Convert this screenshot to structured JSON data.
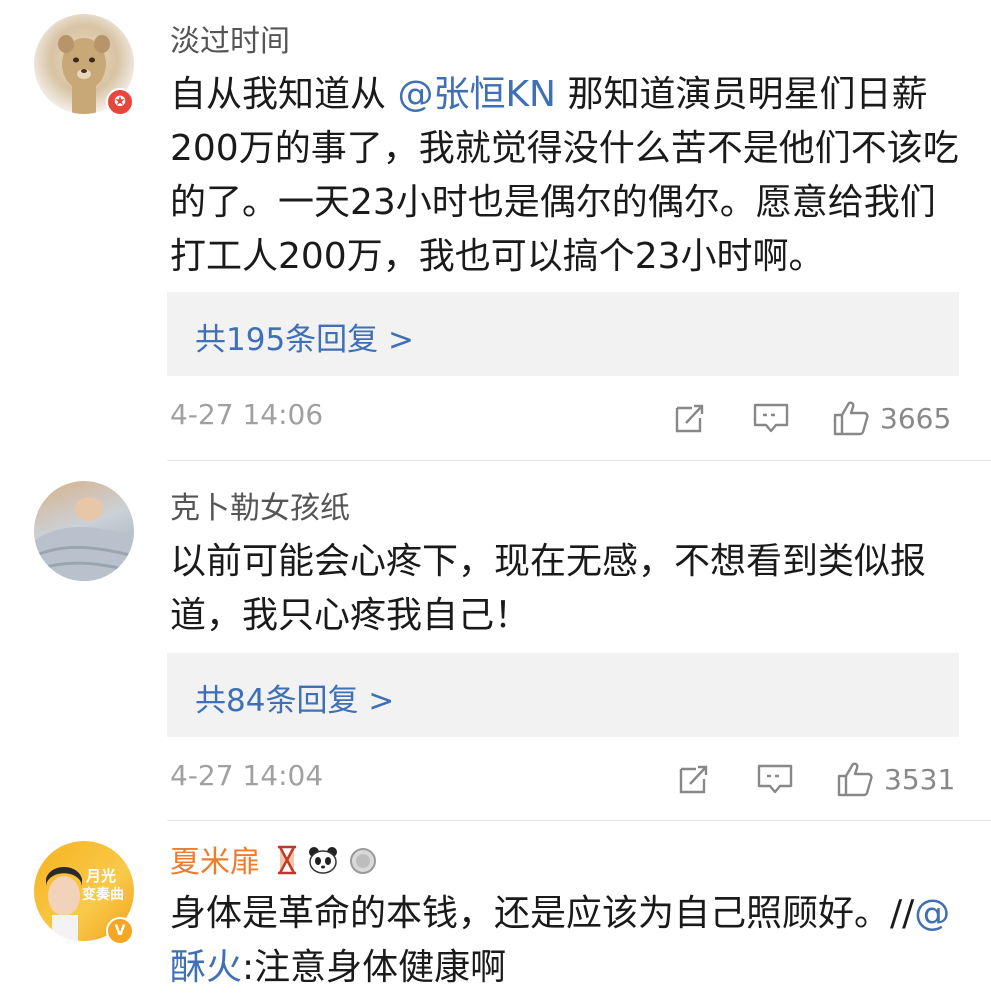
{
  "comments": [
    {
      "username": "淡过时间",
      "text_pre": "自从我知道从 ",
      "mention": "@张恒KN",
      "text_post": " 那知道演员明星们日薪200万的事了，我就觉得没什么苦不是他们不该吃的了。一天23小时也是偶尔的偶尔。愿意给我们打工人200万，我也可以搞个23小时啊。",
      "reply_link": "共195条回复 >",
      "timestamp": "4-27 14:06",
      "likes": "3665",
      "badge": "✪"
    },
    {
      "username": "克卜勒女孩纸",
      "text": "以前可能会心疼下，现在无感，不想看到类似报道，我只心疼我自己！",
      "reply_link": "共84条回复 >",
      "timestamp": "4-27 14:04",
      "likes": "3531"
    },
    {
      "username": "夏米扉",
      "text_pre": "身体是革命的本钱，还是应该为自己照顾好。//",
      "mention": "@酥火",
      "text_post": ":注意身体健康啊",
      "badge": "V",
      "avatar_text_1": "月光",
      "avatar_text_2": "变奏曲"
    }
  ],
  "icons": {
    "share": "share-icon",
    "comment": "comment-icon",
    "like": "thumbs-up-icon"
  },
  "colors": {
    "link": "#3f6fb4",
    "vip_name": "#f07b2a",
    "meta": "#a0a0a0",
    "reply_bg": "#f2f2f2"
  }
}
